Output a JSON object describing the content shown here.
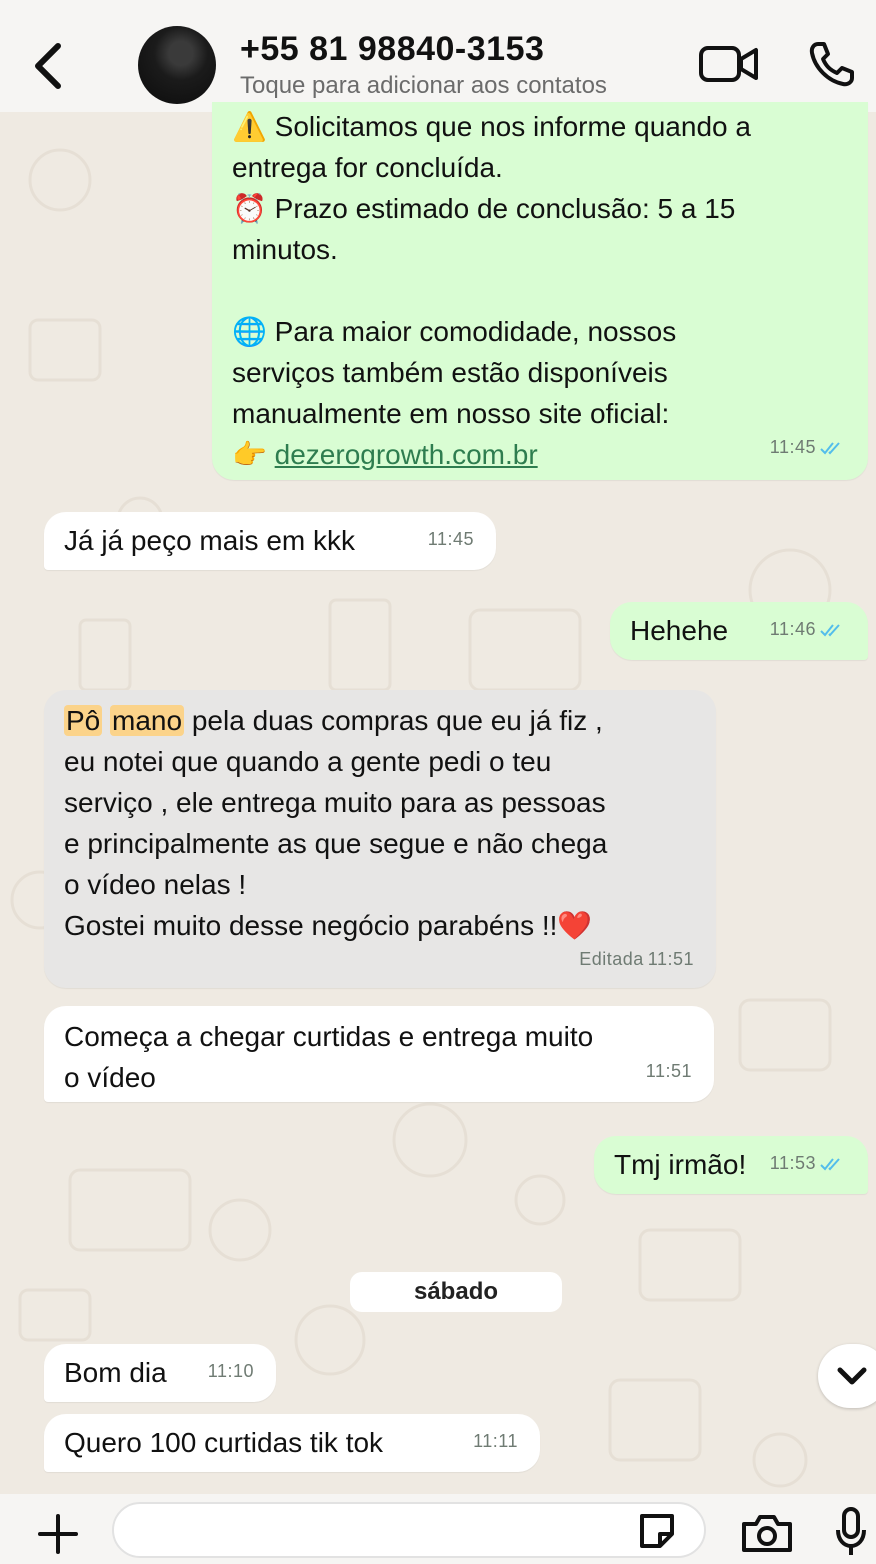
{
  "header": {
    "contact_name": "+55 81 98840-3153",
    "contact_subtitle": "Toque para adicionar aos contatos"
  },
  "messages": [
    {
      "direction": "out",
      "lines": [
        {
          "emoji": "⚠️",
          "text": " Solicitamos que nos informe quando a\nentrega for concluída."
        },
        {
          "emoji": "⏰",
          "text": " Prazo estimado de conclusão: 5 a 15\nminutos."
        },
        {
          "emoji": "🌐",
          "text": " Para maior comodidade, nossos\nserviços também estão disponíveis\nmanualmente em nosso site oficial:"
        },
        {
          "emoji": "👉",
          "link": "dezerogrowth.com.br"
        }
      ],
      "time": "11:45",
      "status": "read"
    },
    {
      "direction": "in",
      "text": "Já já peço mais em kkk",
      "time": "11:45"
    },
    {
      "direction": "out",
      "text": "Hehehe",
      "time": "11:46",
      "status": "read"
    },
    {
      "direction": "in",
      "highlight_1": "Pô",
      "highlight_2": "mano",
      "text_rest": " pela duas compras que eu já fiz ,\neu notei que quando a gente pedi o teu\nserviço , ele entrega muito para as pessoas\ne principalmente as que segue e não chega\no vídeo nelas !\nGostei muito desse negócio parabéns !!",
      "emoji": "❤️",
      "edited_label": "Editada",
      "time": "11:51"
    },
    {
      "direction": "in",
      "text": "Começa a chegar curtidas e entrega muito\no vídeo",
      "time": "11:51"
    },
    {
      "direction": "out",
      "text": "Tmj irmão!",
      "time": "11:53",
      "status": "read"
    },
    {
      "direction": "in",
      "text": "Bom dia",
      "time": "11:10"
    },
    {
      "direction": "in",
      "text": "Quero 100 curtidas tik tok",
      "time": "11:11"
    }
  ],
  "day_separator": "sábado",
  "icons": {
    "back": "chevron-left-icon",
    "video": "video-camera-icon",
    "call": "phone-icon",
    "scroll": "chevron-down-icon",
    "attach": "plus-icon",
    "sticker": "sticker-icon",
    "camera": "camera-icon",
    "mic": "microphone-icon"
  },
  "colors": {
    "outgoing_bubble": "#d9fdd3",
    "incoming_bubble": "#ffffff",
    "highlight": "#fbd38a",
    "read_ticks": "#53bdeb",
    "link": "#2e7d4f"
  }
}
